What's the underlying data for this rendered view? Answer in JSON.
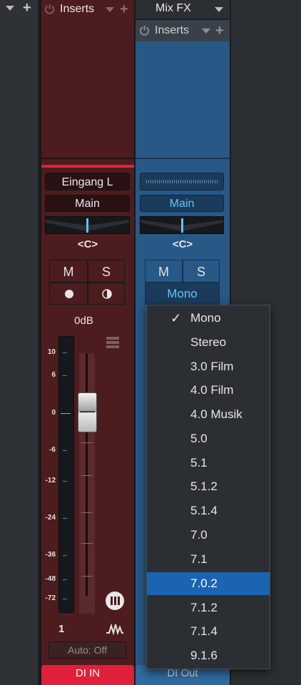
{
  "left_strip": {
    "icons": [
      "chevron-down-icon",
      "plus-icon"
    ]
  },
  "channel1": {
    "inserts_label": "Inserts",
    "input_label": "Eingang L",
    "output_label": "Main",
    "pan_label": "<C>",
    "mute_label": "M",
    "solo_label": "S",
    "level": "0dB",
    "scale": [
      "10",
      "6",
      "0",
      "-6",
      "-12",
      "-24",
      "-36",
      "-48",
      "-72"
    ],
    "number": "1",
    "automation": "Auto: Off",
    "name": "DI IN",
    "name_color": "#e0203a"
  },
  "channel2": {
    "header": "Mix FX",
    "inserts_label": "Inserts",
    "output_label": "Main",
    "pan_label": "<C>",
    "mute_label": "M",
    "solo_label": "S",
    "mode_label": "Mono",
    "name": "DI Out"
  },
  "dropdown": {
    "checked": "Mono",
    "selected": "7.0.2",
    "options": [
      "Mono",
      "Stereo",
      "3.0 Film",
      "4.0 Film",
      "4.0 Musik",
      "5.0",
      "5.1",
      "5.1.2",
      "5.1.4",
      "7.0",
      "7.1",
      "7.0.2",
      "7.1.2",
      "7.1.4",
      "9.1.6"
    ]
  },
  "colors": {
    "accent": "#5fc6f3",
    "red_channel": "#4d1c1e",
    "blue_channel": "#285886",
    "selection": "#1a64b1"
  }
}
